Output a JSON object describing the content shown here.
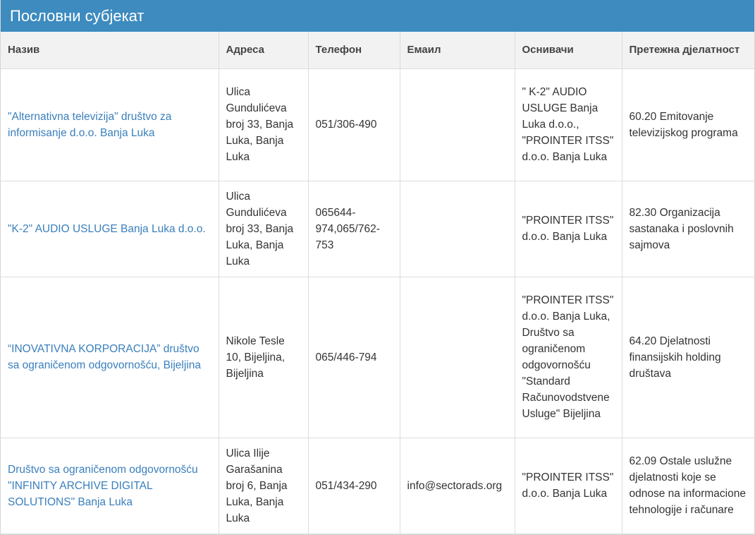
{
  "panel": {
    "title": "Пословни субјекат"
  },
  "table": {
    "headers": [
      "Назив",
      "Адреса",
      "Телефон",
      "Емаил",
      "Оснивачи",
      "Претежна дјелатност"
    ],
    "rows": [
      {
        "name": "\"Alternativna televizija\" društvo za informisanje d.o.o. Banja Luka",
        "address": "Ulica Gundulićeva broj 33, Banja Luka, Banja Luka",
        "phone": "051/306-490",
        "email": "",
        "founders": "\" K-2\" AUDIO USLUGE Banja Luka d.o.o., \"PROINTER ITSS\" d.o.o. Banja Luka",
        "activity": "60.20 Emitovanje televizijskog programa"
      },
      {
        "name": "\"K-2\" AUDIO USLUGE Banja Luka d.o.o.",
        "address": "Ulica Gundulićeva broj 33, Banja Luka, Banja Luka",
        "phone": "065644-974,065/762-753",
        "email": "",
        "founders": "\"PROINTER ITSS\" d.o.o. Banja Luka",
        "activity": "82.30 Organizacija sastanaka i poslovnih sajmova"
      },
      {
        "name": "“INOVATIVNA KORPORACIJA” društvo sa ograničenom odgovornošću, Bijeljina",
        "address": "Nikole Tesle 10, Bijeljina, Bijeljina",
        "phone": "065/446-794",
        "email": "",
        "founders": "\"PROINTER ITSS\" d.o.o. Banja Luka, Društvo sa ograničenom odgovornošću \"Standard Računovodstvene Usluge\" Bijeljina",
        "activity": "64.20 Djelatnosti finansijskih holding društava"
      },
      {
        "name": "Društvo sa ograničenom odgovornošću \"INFINITY ARCHIVE DIGITAL SOLUTIONS\" Banja Luka",
        "address": "Ulica Ilije Garašanina broj 6, Banja Luka, Banja Luka",
        "phone": "051/434-290",
        "email": "info@sectorads.org",
        "founders": "\"PROINTER ITSS\" d.o.o. Banja Luka",
        "activity": "62.09 Ostale uslužne djelatnosti koje se odnose na informacione tehnologije i računare"
      }
    ]
  }
}
